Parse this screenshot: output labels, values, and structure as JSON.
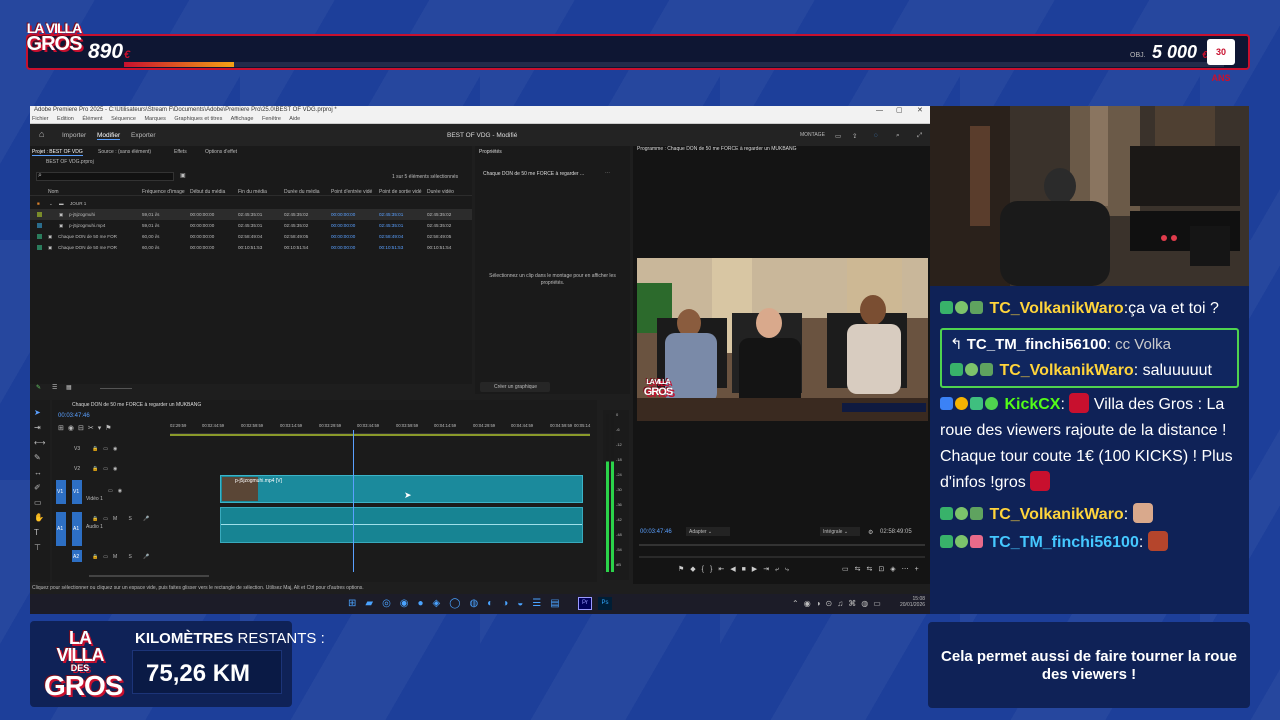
{
  "overlay": {
    "logo": {
      "line1": "LA VILLA",
      "line2": "DES",
      "line3": "GROS"
    },
    "goal": {
      "current": "890",
      "currency": "€",
      "label": "OBJ.",
      "max": "5 000",
      "max_currency": "€",
      "progress_fraction": 0.1,
      "badge": "30 ANS"
    },
    "km": {
      "label_bold": "KILOMÈTRES",
      "label_rest": " RESTANTS :",
      "value": "75,26 KM"
    },
    "info_text": "Cela permet aussi de faire tourner la roue des viewers !"
  },
  "premiere": {
    "title_bar": "Adobe Premiere Pro 2025 - C:\\Utilisateurs\\Stream F\\Documents\\Adobe\\Premiere Pro\\25.0\\BEST OF VDG.prproj *",
    "menu": [
      "Fichier",
      "Edition",
      "Élément",
      "Séquence",
      "Marques",
      "Graphiques et titres",
      "Affichage",
      "Fenêtre",
      "Aide"
    ],
    "header": {
      "import": "Importer",
      "edit": "Modifier",
      "export": "Exporter",
      "project_title": "BEST OF VDG - Modifié",
      "workspace": "MONTAGE"
    },
    "project_tabs": [
      "Projet : BEST OF VDG",
      "Source : (sans élément)",
      "Effets",
      "Options d'effet"
    ],
    "project_file": "BEST OF VDG.prproj",
    "selection_count": "1 sur 5 éléments sélectionnés",
    "columns": [
      "Nom",
      "Fréquence d'image",
      "Début du média",
      "Fin du média",
      "Durée du média",
      "Point d'entrée vidé",
      "Point de sortie vidé",
      "Durée vidéo"
    ],
    "bin": "JOUR 1",
    "rows": [
      {
        "name": "p-j5jzogmuhi",
        "cells": [
          "59,01 i/s",
          "00:00:00:00",
          "02:45:35:01",
          "02:45:35:02",
          "00:00:00:00",
          "02:45:35:01",
          "02:45:35:02"
        ],
        "color": "#7a8c2a",
        "selected": true
      },
      {
        "name": "p-j5jzogmuhi.mp4",
        "cells": [
          "59,01 i/s",
          "00:00:00:00",
          "02:45:35:01",
          "02:45:35:02",
          "00:00:00:00",
          "02:45:35:01",
          "02:45:35:02"
        ],
        "color": "#2a6c8c",
        "selected": false
      },
      {
        "name": "Chaque DON de 50 me FOR",
        "cells": [
          "60,00 i/s",
          "00:00:00:00",
          "02:58:49:04",
          "02:58:49:05",
          "00:00:00:00",
          "02:58:49:04",
          "02:58:49:05"
        ],
        "color": "#2a7c5c",
        "selected": false
      },
      {
        "name": "Chaque DON de 50 me FOR",
        "cells": [
          "60,00 i/s",
          "00:00:00:00",
          "00:10:51:53",
          "00:10:51:54",
          "00:00:00:00",
          "00:10:51:53",
          "00:10:51:54"
        ],
        "color": "#2a7c5c",
        "selected": false
      }
    ],
    "properties": {
      "tab": "Propriétés",
      "item": "Chaque DON de 50 me FORCE à regarder ...",
      "hint": "Sélectionnez un clip dans le montage pour en afficher les propriétés.",
      "create_graphic": "Créer un graphique"
    },
    "program": {
      "tab": "Programme : Chaque DON de 50 me FORCE à regarder un MUKBANG",
      "timecode": "00:03:47:46",
      "fit": "Adapter",
      "quality": "Intégrale",
      "duration": "02:58:49:05"
    },
    "timeline": {
      "tab": "Chaque DON de 50 me FORCE à regarder un MUKBANG",
      "timecode": "00:03:47:46",
      "ruler": [
        "02:29:59",
        "00:02:44:59",
        "00:02:59:59",
        "00:03:14:59",
        "00:03:29:59",
        "00:03:44:59",
        "00:03:59:59",
        "00:04:14:59",
        "00:04:29:59",
        "00:04:44:59",
        "00:04:59:59",
        "00:05:14"
      ],
      "tracks": {
        "v3": "V3",
        "v2": "V2",
        "v1": "V1",
        "video1": "Vidéo 1",
        "a1": "A1",
        "audio1": "Audio 1",
        "a2": "A2"
      },
      "clip_video": "p-j5jzogmuhi.mp4 [V]",
      "meter_ticks": [
        "0",
        "-6",
        "-12",
        "-18",
        "-24",
        "-30",
        "-36",
        "-42",
        "-48",
        "-54",
        "dB"
      ]
    },
    "status": "Cliquez pour sélectionner ou cliquez sur un espace vide, puis faites glisser vers le rectangle de sélection. Utilisez Maj, Alt et Ctrl pour d'autres options.",
    "clock": {
      "time": "15:08",
      "date": "20/01/2026"
    }
  },
  "chat": {
    "messages": [
      {
        "user": "TC_VolkanikWaro",
        "text": "ça va et toi ?"
      },
      {
        "reply_to": "TC_TM_finchi56100",
        "reply_preview": "cc Volka",
        "user": "TC_VolkanikWaro",
        "text": "saluuuuut"
      },
      {
        "user": "KickCX",
        "text": "Villa des Gros : La roue des viewers rajoute de la distance ! Chaque tour coute 1€ (100 KICKS) ! Plus d'infos !gros"
      },
      {
        "user": "TC_VolkanikWaro",
        "text": ""
      },
      {
        "user": "TC_TM_finchi56100",
        "text": ""
      }
    ]
  }
}
